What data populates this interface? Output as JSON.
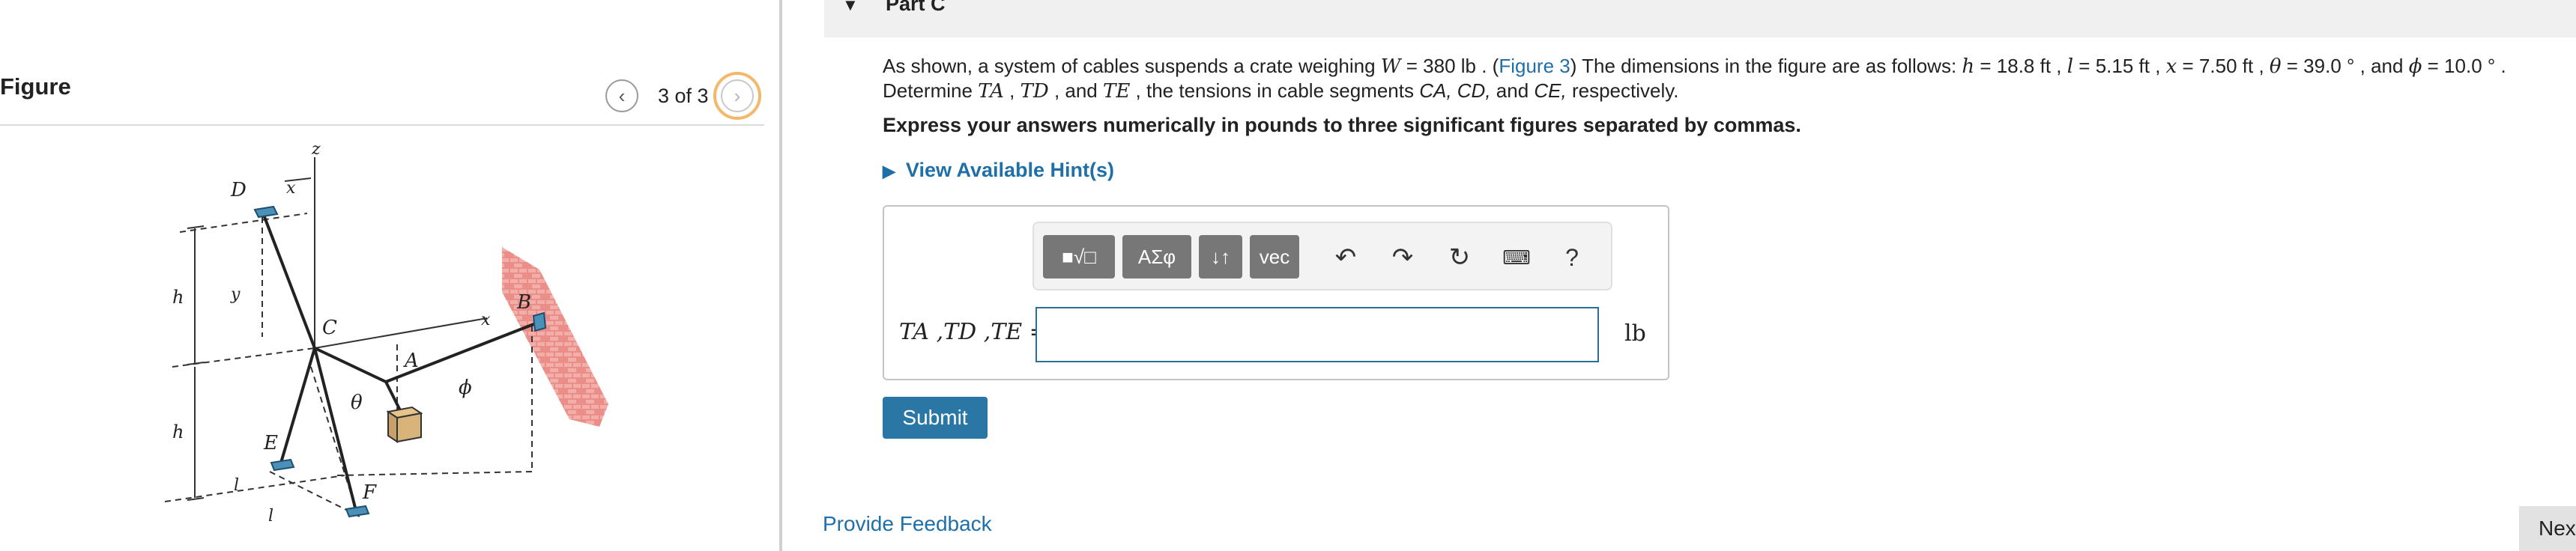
{
  "figure_panel": {
    "title": "Figure",
    "counter": "3 of 3",
    "figure_labels": {
      "D": "D",
      "z": "z",
      "x_dim": "x",
      "y": "y",
      "h1": "h",
      "h2": "h",
      "C": "C",
      "A": "A",
      "B": "B",
      "x_axis": "x",
      "theta": "θ",
      "phi": "ϕ",
      "E": "E",
      "F": "F",
      "l1": "l",
      "l2": "l"
    }
  },
  "part": {
    "title": "Part C"
  },
  "problem": {
    "intro": "As shown, a system of cables suspends a crate weighing ",
    "W_var": "W",
    "W_value": " = 380 lb . (",
    "figure_link": "Figure 3",
    "dims_intro": ") The dimensions in the figure are as follows: ",
    "h_var": "h",
    "h_value": " = 18.8 ft , ",
    "l_var": "l",
    "l_value": " = 5.15 ft , ",
    "x_var": "x",
    "x_value": " = 7.50 ft , ",
    "theta_var": "θ",
    "theta_value": " = 39.0 ° , and ",
    "phi_var": "ϕ",
    "phi_value": " = 10.0 ° .",
    "line2_a": "Determine ",
    "TA": "TA",
    "comma1": " , ",
    "TD": "TD",
    "comma2": " , and ",
    "TE": "TE",
    "line2_b": " , the tensions in cable segments ",
    "segments": "CA, CD,",
    "and_word": " and ",
    "segment_last": "CE,",
    "line2_c": " respectively."
  },
  "instruction": "Express your answers numerically in pounds to three significant figures separated by commas.",
  "hint": {
    "label": "View Available Hint(s)"
  },
  "toolbar": {
    "templates": "■√□",
    "greek": "ΑΣφ",
    "arrows": "↓↑",
    "vec": "vec",
    "undo_icon": "undo-icon",
    "redo_icon": "redo-icon",
    "reset_icon": "reset-icon",
    "keyboard_icon": "keyboard-icon",
    "help": "?"
  },
  "answer": {
    "label": "TA ,TD ,TE =",
    "value": "",
    "unit": "lb"
  },
  "submit_label": "Submit",
  "feedback_label": "Provide Feedback",
  "next_label": "Nex",
  "colors": {
    "link": "#1f6fa8",
    "submit": "#2a77a6",
    "toolbar_button": "#777777",
    "input_border": "#2a6f96",
    "next_ring": "#f4b86a",
    "brick": "#d94a4a"
  }
}
